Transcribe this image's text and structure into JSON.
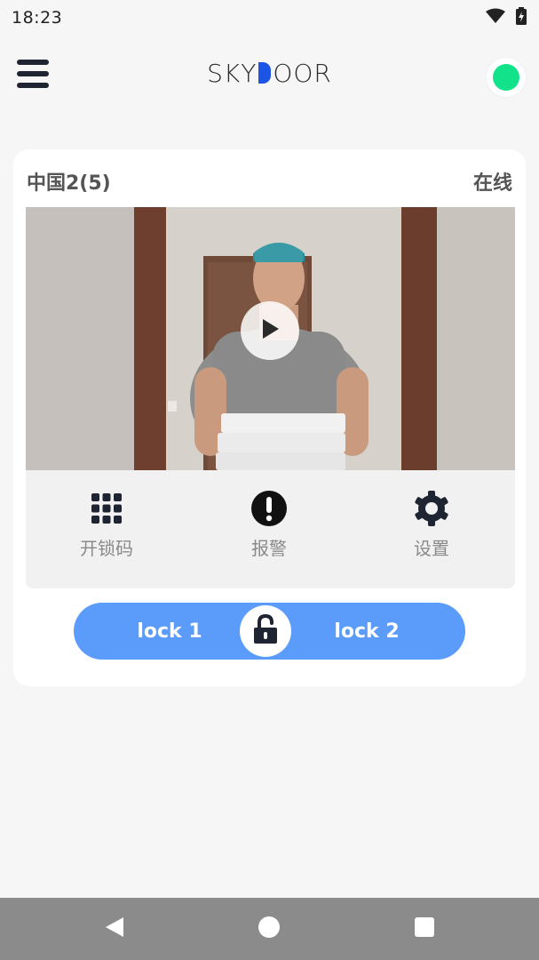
{
  "status_bar": {
    "time": "18:23",
    "wifi_icon": "wifi-icon",
    "battery_icon": "battery-charging-icon"
  },
  "header": {
    "logo_text_left": "SKY",
    "logo_text_right": "OOR",
    "online_color": "#12e38a"
  },
  "device": {
    "name": "中国2(5)",
    "status": "在线",
    "actions": [
      {
        "label": "开锁码",
        "icon": "keypad-icon"
      },
      {
        "label": "报警",
        "icon": "alarm-icon"
      },
      {
        "label": "设置",
        "icon": "settings-icon"
      }
    ],
    "locks": {
      "lock1": "lock 1",
      "lock2": "lock 2",
      "center_icon": "unlock-icon"
    }
  },
  "colors": {
    "accent": "#5b9bfa",
    "brand": "#1c55e6",
    "online": "#12e38a"
  }
}
